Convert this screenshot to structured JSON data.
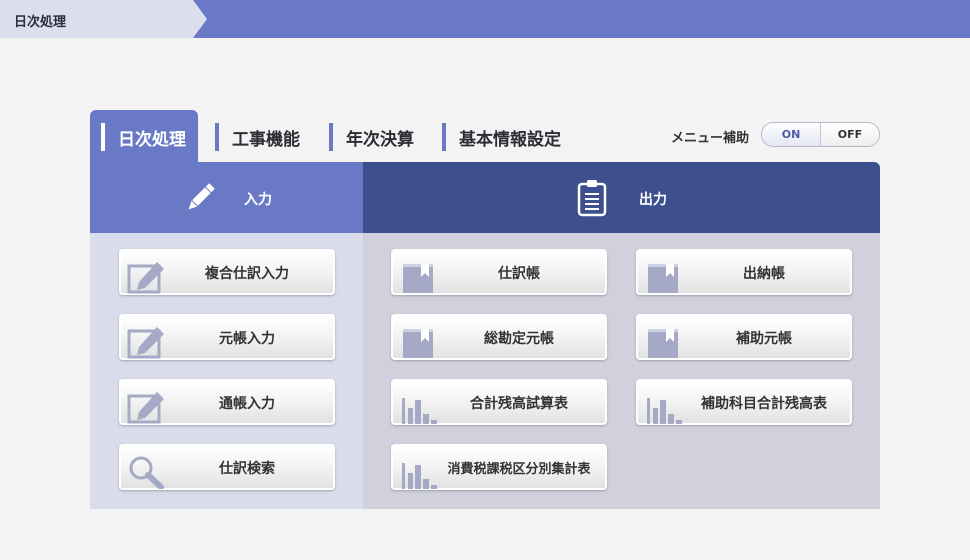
{
  "breadcrumb": {
    "label": "日次処理"
  },
  "tabs": [
    {
      "label": "日次処理",
      "active": true
    },
    {
      "label": "工事機能",
      "active": false
    },
    {
      "label": "年次決算",
      "active": false
    },
    {
      "label": "基本情報設定",
      "active": false
    }
  ],
  "menu_assist": {
    "label": "メニュー補助",
    "on_label": "ON",
    "off_label": "OFF",
    "selected": "ON"
  },
  "input_panel": {
    "title": "入力",
    "icon": "pencil-icon",
    "buttons": [
      {
        "label": "複合仕訳入力",
        "icon": "edit-icon"
      },
      {
        "label": "元帳入力",
        "icon": "edit-icon"
      },
      {
        "label": "通帳入力",
        "icon": "edit-icon"
      },
      {
        "label": "仕訳検索",
        "icon": "search-icon"
      }
    ]
  },
  "output_panel": {
    "title": "出力",
    "icon": "clipboard-icon",
    "buttons": [
      {
        "label": "仕訳帳",
        "icon": "ledger-icon"
      },
      {
        "label": "出納帳",
        "icon": "ledger-icon"
      },
      {
        "label": "総勘定元帳",
        "icon": "ledger-icon"
      },
      {
        "label": "補助元帳",
        "icon": "ledger-icon"
      },
      {
        "label": "合計残高試算表",
        "icon": "bar-chart-icon"
      },
      {
        "label": "補助科目合計残高表",
        "icon": "bar-chart-icon"
      },
      {
        "label": "消費税課税区分別集計表",
        "icon": "bar-chart-icon"
      }
    ]
  },
  "colors": {
    "accent": "#6979c6",
    "output_header": "#3d4f8e",
    "input_panel_bg": "#d9dcea",
    "output_panel_bg": "#d0d1dd",
    "icon": "#a5a9c5"
  }
}
